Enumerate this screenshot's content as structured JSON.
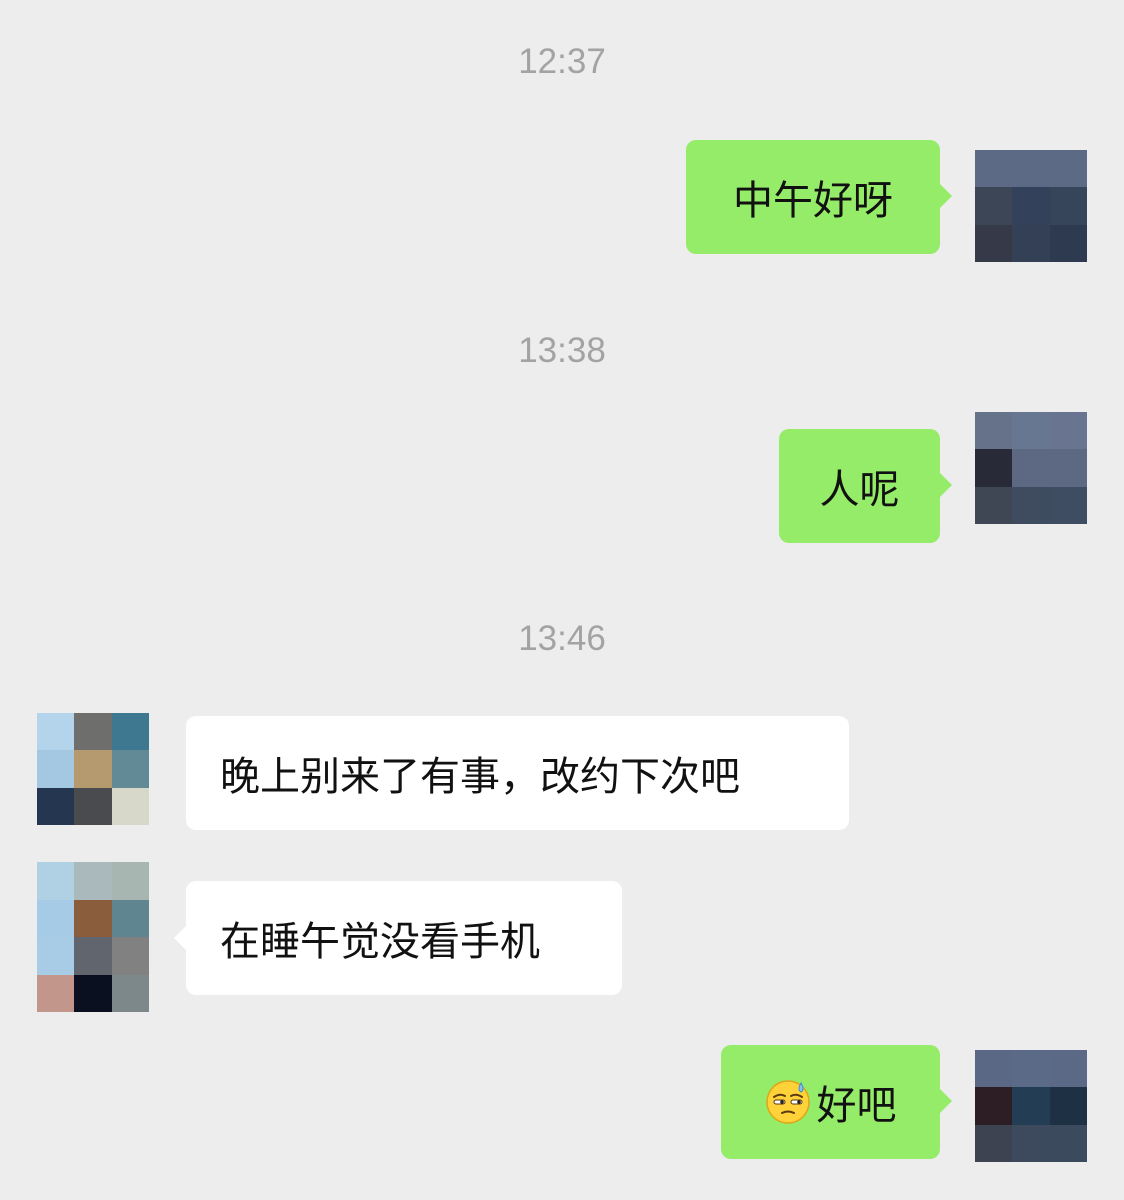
{
  "messages": [
    {
      "type": "time",
      "text": "12:37"
    },
    {
      "type": "sent",
      "text": "中午好呀"
    },
    {
      "type": "time",
      "text": "13:38"
    },
    {
      "type": "sent",
      "text": "人呢"
    },
    {
      "type": "time",
      "text": "13:46"
    },
    {
      "type": "received",
      "text": "晚上别来了有事，改约下次吧"
    },
    {
      "type": "received",
      "text": "在睡午觉没看手机"
    },
    {
      "type": "sent",
      "emoji": "sweat-face-emoji",
      "text": "好吧"
    }
  ],
  "colors": {
    "background": "#ededed",
    "sent_bubble": "#95ec69",
    "received_bubble": "#ffffff",
    "timestamp": "#a3a3a3"
  }
}
